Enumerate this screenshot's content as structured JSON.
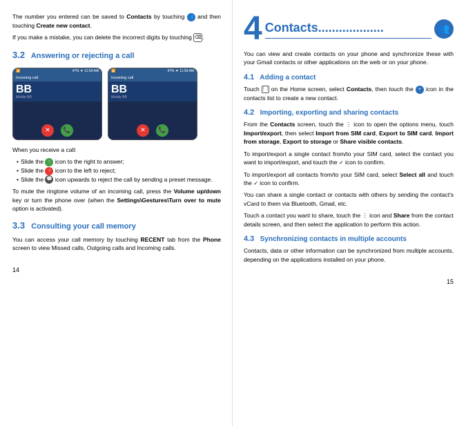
{
  "left": {
    "intro_p1_before": "The number you entered can be saved to ",
    "intro_p1_bold": "Contacts",
    "intro_p1_after": " by touching",
    "intro_p2_before": "If you make a mistake, you can delete the incorrect digits by touching",
    "section_3_2": {
      "num": "3.2",
      "title": "Answering or rejecting a call"
    },
    "phone_1": {
      "status": "47% ▼ 11:59 AM",
      "call_label": "Incoming call",
      "initials": "BB",
      "subtitle": "Mobile BB"
    },
    "phone_2": {
      "status": "47% ▼ 11:59 AM",
      "call_label": "Incoming call",
      "initials": "BB",
      "subtitle": "Mobile BB"
    },
    "receive_intro": "When you receive a call:",
    "bullets": [
      "Slide the      icon to the right to answer;",
      "Slide the      icon to the left to reject;",
      "Slide the      icon upwards to reject the call by sending a preset message."
    ],
    "mute_p": "To mute the ringtone volume of an incoming call, press the ",
    "mute_bold": "Volume up/down",
    "mute_after": " key or turn the phone over (when the ",
    "mute_bold2": "Settings\\Gestures\\Turn over to mute",
    "mute_end": " option is activated).",
    "section_3_3": {
      "num": "3.3",
      "title": "Consulting your call memory"
    },
    "consult_p_before": "You can access your call memory by touching ",
    "consult_bold": "RECENT",
    "consult_after": " tab from the ",
    "consult_bold2": "Phone",
    "consult_end": " screen to view Missed calls, Outgoing calls and Incoming calls.",
    "page_number": "14"
  },
  "right": {
    "chapter_number": "4",
    "chapter_title": "Contacts...................",
    "intro_p": "You can view and create contacts on your phone and synchronize these with your Gmail contacts or other applications on the web or on your phone.",
    "section_4_1": {
      "num": "4.1",
      "title": "Adding a contact"
    },
    "add_p_before": "Touch",
    "add_p_bold": "Contacts",
    "add_p_after": ", then touch the",
    "add_p_end": " icon in the contacts list to create a new contact.",
    "section_4_2": {
      "num": "4.2",
      "title": "Importing, exporting and sharing contacts"
    },
    "import_p1_before": "From the ",
    "import_p1_bold": "Contacts",
    "import_p1_after": " screen, touch the   icon to open the options menu, touch ",
    "import_p1_bold2": "Import/export",
    "import_p1_after2": ", then select ",
    "import_p1_bold3": "Import from SIM card",
    "import_p1_comma": ", ",
    "import_p1_bold4": "Export to SIM card",
    "import_p1_comma2": ", ",
    "import_p1_bold5": "Import from storage",
    "import_p1_comma3": ", ",
    "import_p1_bold6": "Export to storage",
    "import_p1_or": " or ",
    "import_p1_bold7": "Share visible contacts",
    "import_p1_end": ".",
    "import_p2": "To import/export a single contact from/to your SIM card, select the contact you want to import/export, and touch the      icon to confirm.",
    "import_p3_before": "To import/export all contacts from/to your SIM card, select ",
    "import_p3_bold": "Select all",
    "import_p3_after": " and touch the      icon to confirm.",
    "import_p4": "You can share a single contact or contacts with others by sending the contact's vCard to them via Bluetooth, Gmail, etc.",
    "import_p5_before": "Touch a contact you want to share, touch the   icon and ",
    "import_p5_bold": "Share",
    "import_p5_after": " from the contact details screen, and then select the application to perform this action.",
    "section_4_3": {
      "num": "4.3",
      "title": "Synchronizing contacts in multiple accounts"
    },
    "sync_p": "Contacts, data or other information can be synchronized from multiple accounts, depending on the applications installed on your phone.",
    "page_number": "15"
  }
}
